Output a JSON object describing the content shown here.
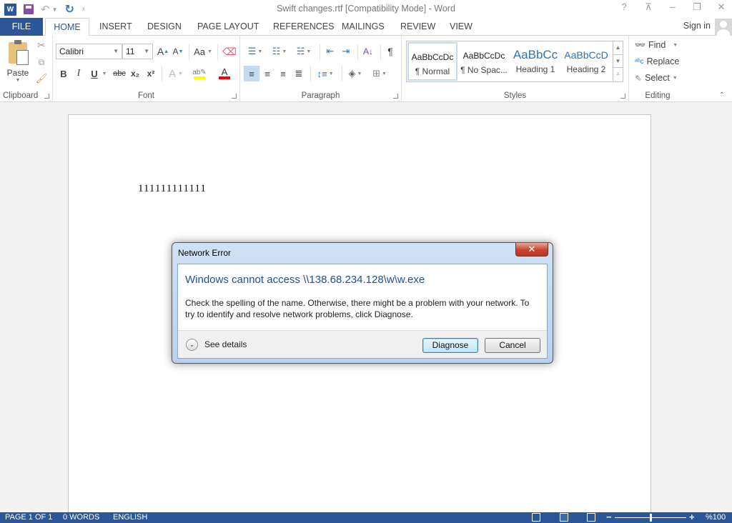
{
  "window": {
    "title": "Swift changes.rtf [Compatibility Mode] - Word",
    "app_icon": "W",
    "controls": [
      "help-icon",
      "ribbon-display-icon",
      "minimize-icon",
      "restore-icon",
      "close-icon"
    ]
  },
  "qat": {
    "save": "save-icon",
    "undo": "undo-icon",
    "redo": "redo-icon",
    "customize": "customize-icon"
  },
  "tabs": {
    "file": "FILE",
    "items": [
      "HOME",
      "INSERT",
      "DESIGN",
      "PAGE LAYOUT",
      "REFERENCES",
      "MAILINGS",
      "REVIEW",
      "VIEW"
    ],
    "active": "HOME",
    "sign_in": "Sign in"
  },
  "ribbon": {
    "clipboard": {
      "label": "Clipboard",
      "paste": "Paste"
    },
    "font": {
      "label": "Font",
      "font_name": "Calibri",
      "font_size": "11",
      "change_case": "Aa",
      "bold": "B",
      "italic": "I",
      "underline": "U",
      "strikethrough": "abc",
      "subscript": "x₂",
      "superscript": "x²",
      "highlight_color": "#ffff00",
      "font_color": "#ff0000"
    },
    "paragraph": {
      "label": "Paragraph"
    },
    "styles": {
      "label": "Styles",
      "items": [
        {
          "preview": "AaBbCcDc",
          "name": "¶ Normal",
          "selected": true
        },
        {
          "preview": "AaBbCcDc",
          "name": "¶ No Spac...",
          "selected": false
        },
        {
          "preview": "AaBbCc",
          "name": "Heading 1",
          "selected": false
        },
        {
          "preview": "AaBbCcD",
          "name": "Heading 2",
          "selected": false
        }
      ]
    },
    "editing": {
      "label": "Editing",
      "find": "Find",
      "replace": "Replace",
      "select": "Select"
    }
  },
  "document": {
    "text": "111111111111"
  },
  "dialog": {
    "title": "Network Error",
    "main_instruction": "Windows cannot access \\\\138.68.234.128\\w\\w.exe",
    "message": "Check the spelling of the name. Otherwise, there might be a problem with your network. To try to identify and resolve network problems, click Diagnose.",
    "see_details": "See details",
    "diagnose": "Diagnose",
    "cancel": "Cancel"
  },
  "statusbar": {
    "page": "PAGE 1 OF 1",
    "words": "0 WORDS",
    "language": "ENGLISH",
    "zoom": "%100",
    "zoom_percent": 100
  },
  "colors": {
    "accent": "#2b579a",
    "heading": "#2e74b5",
    "dialog_instruction": "#1f4e9a"
  }
}
